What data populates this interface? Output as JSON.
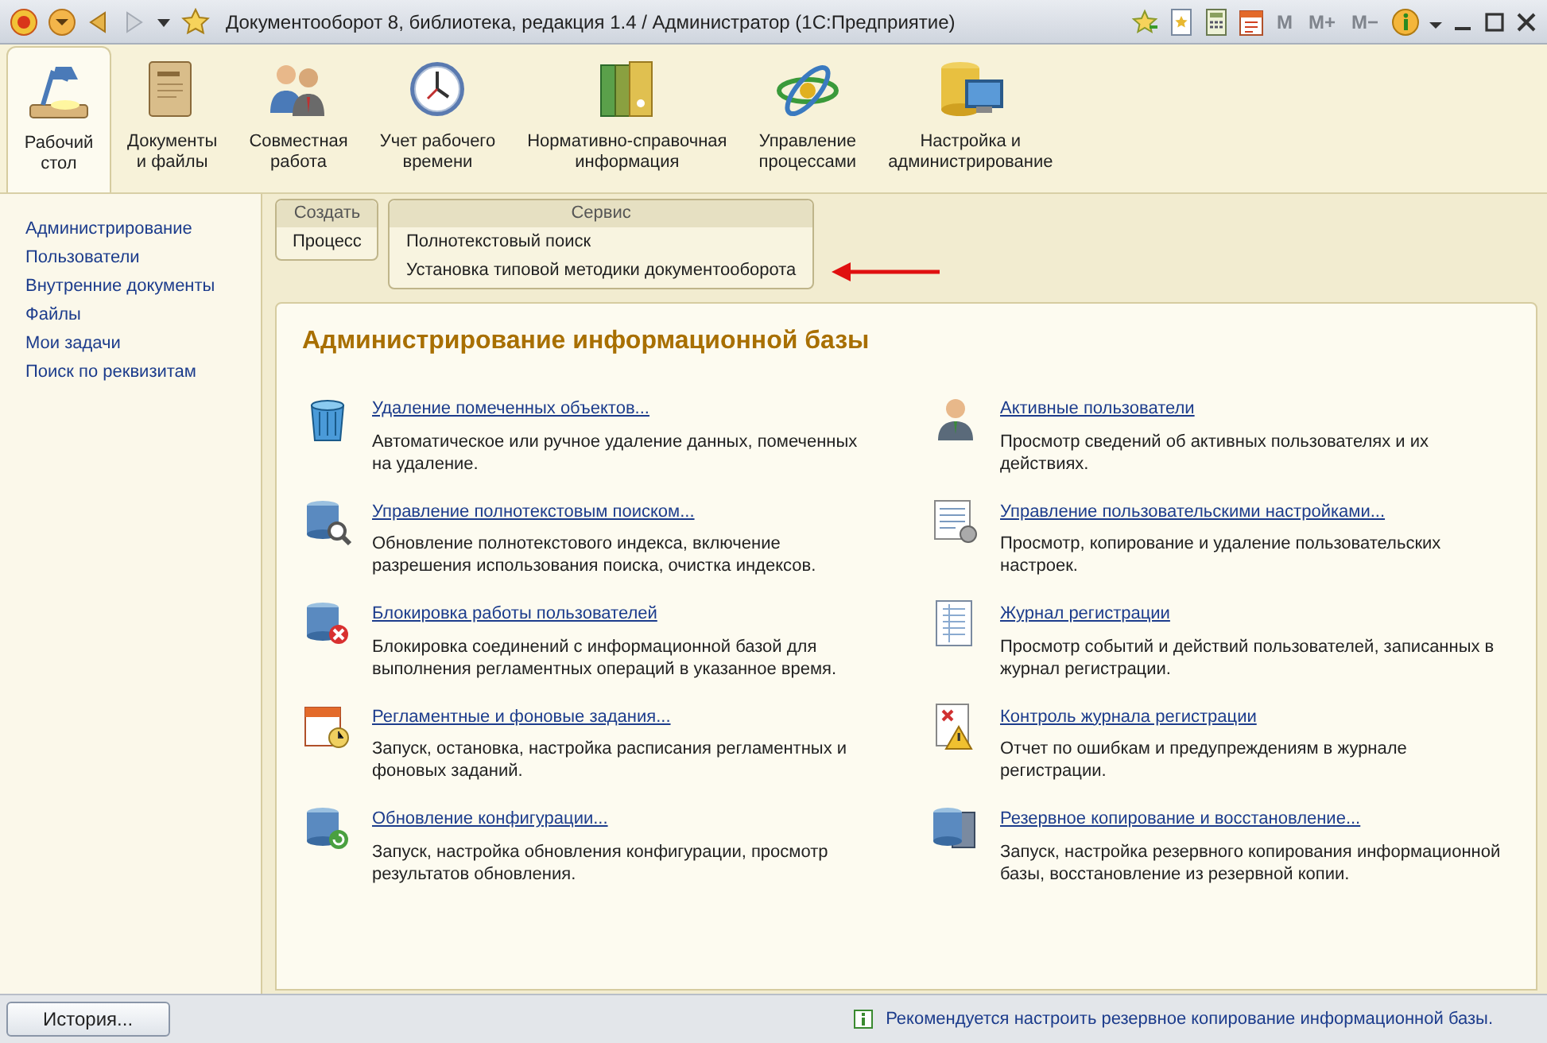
{
  "window": {
    "title": "Документооборот 8, библиотека, редакция 1.4 / Администратор  (1С:Предприятие)"
  },
  "memory_buttons": [
    {
      "label": "M",
      "disabled": true
    },
    {
      "label": "M+",
      "disabled": true
    },
    {
      "label": "M−",
      "disabled": true
    }
  ],
  "sections": [
    {
      "label": "Рабочий\nстол",
      "selected": true
    },
    {
      "label": "Документы\nи файлы",
      "selected": false
    },
    {
      "label": "Совместная\nработа",
      "selected": false
    },
    {
      "label": "Учет рабочего\nвремени",
      "selected": false
    },
    {
      "label": "Нормативно-справочная\nинформация",
      "selected": false
    },
    {
      "label": "Управление\nпроцессами",
      "selected": false
    },
    {
      "label": "Настройка и\nадминистрирование",
      "selected": false
    }
  ],
  "sidebar": {
    "items": [
      "Администрирование",
      "Пользователи",
      "Внутренние документы",
      "Файлы",
      "Мои задачи",
      "Поиск по реквизитам"
    ]
  },
  "command_groups": [
    {
      "title": "Создать",
      "commands": [
        "Процесс"
      ]
    },
    {
      "title": "Сервис",
      "commands": [
        "Полнотекстовый поиск",
        "Установка типовой методики документооборота"
      ]
    }
  ],
  "panel": {
    "title": "Администрирование информационной базы",
    "items": [
      {
        "link": "Удаление помеченных объектов...",
        "description": "Автоматическое или ручное удаление данных, помеченных на удаление."
      },
      {
        "link": "Активные пользователи",
        "description": "Просмотр сведений об активных пользователях и их действиях."
      },
      {
        "link": "Управление полнотекстовым поиском...",
        "description": "Обновление полнотекстового индекса, включение разрешения использования поиска, очистка индексов."
      },
      {
        "link": "Управление пользовательскими настройками...",
        "description": "Просмотр, копирование и удаление пользовательских настроек."
      },
      {
        "link": "Блокировка работы пользователей",
        "description": "Блокировка соединений с информационной базой для выполнения регламентных операций в указанное время."
      },
      {
        "link": "Журнал регистрации",
        "description": "Просмотр событий и действий пользователей, записанных в журнал регистрации."
      },
      {
        "link": "Регламентные и фоновые задания...",
        "description": "Запуск, остановка, настройка расписания регламентных и фоновых заданий."
      },
      {
        "link": "Контроль журнала регистрации",
        "description": "Отчет по ошибкам и предупреждениям в журнале регистрации."
      },
      {
        "link": "Обновление конфигурации...",
        "description": "Запуск, настройка обновления конфигурации, просмотр результатов обновления."
      },
      {
        "link": "Резервное копирование и восстановление...",
        "description": "Запуск, настройка резервного копирования информационной базы, восстановление из резервной копии."
      }
    ]
  },
  "status_bar": {
    "history_button": "История...",
    "message": "Рекомендуется настроить резервное копирование информационной базы."
  }
}
